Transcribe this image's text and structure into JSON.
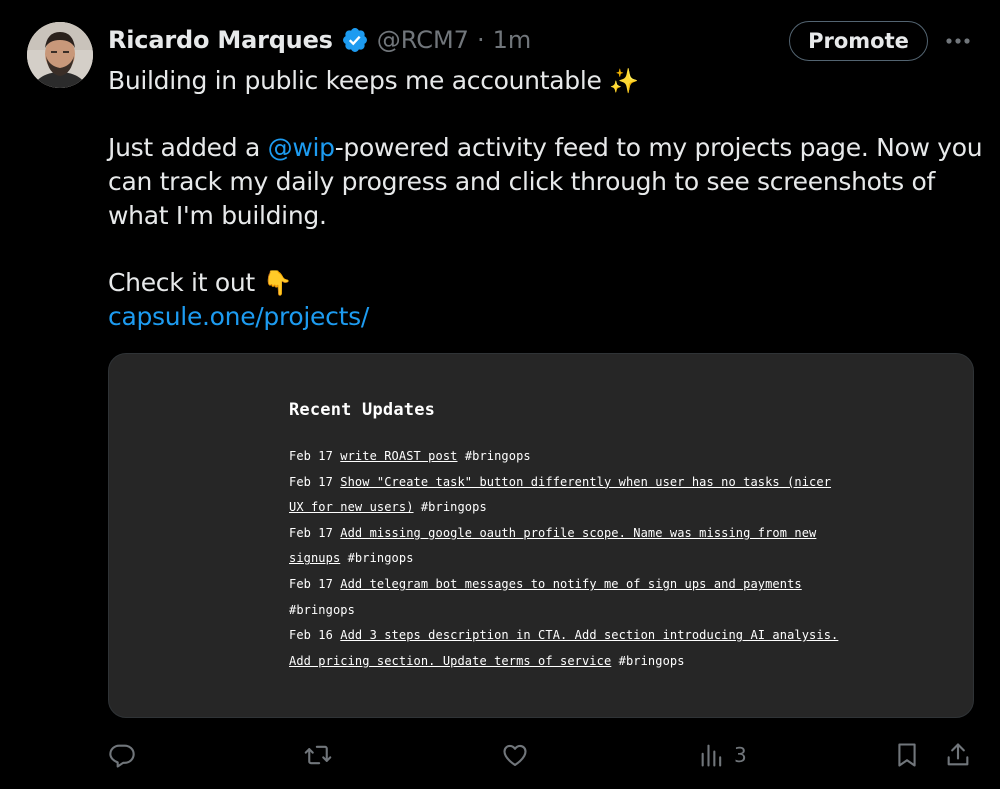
{
  "tweet": {
    "author_name": "Ricardo Marques",
    "handle": "@RCM7",
    "separator": "·",
    "time": "1m",
    "promote_label": "Promote",
    "text": {
      "line1": "Building in public keeps me accountable",
      "emoji_sparkles": "✨",
      "p2_before": "Just added a ",
      "p2_mention": "@wip",
      "p2_after": "-powered activity feed to my projects page. Now you can track my daily progress and click through to see screenshots of what I'm building.",
      "p3": "Check it out",
      "emoji_point": "👇",
      "link": "capsule.one/projects/"
    },
    "card": {
      "title": "Recent Updates",
      "updates": [
        {
          "date": "Feb 17",
          "text": "write ROAST post",
          "tag": "#bringops"
        },
        {
          "date": "Feb 17",
          "text": "Show \"Create task\" button differently when user has no tasks (nicer UX for new users)",
          "tag": "#bringops"
        },
        {
          "date": "Feb 17",
          "text": "Add missing google oauth profile scope. Name was missing from new signups",
          "tag": "#bringops"
        },
        {
          "date": "Feb 17",
          "text": "Add telegram bot messages to notify me of sign ups and payments",
          "tag": "#bringops"
        },
        {
          "date": "Feb 16",
          "text": "Add 3 steps description in CTA. Add section introducing AI analysis. Add pricing section. Update terms of service",
          "tag": "#bringops"
        }
      ]
    },
    "actions": {
      "reply_icon": "reply-icon",
      "retweet_icon": "retweet-icon",
      "like_icon": "heart-icon",
      "views_icon": "analytics-icon",
      "views_count": "3",
      "bookmark_icon": "bookmark-icon",
      "share_icon": "share-icon"
    }
  },
  "colors": {
    "background": "#000000",
    "text": "#e7e9ea",
    "muted": "#71767b",
    "accent": "#1d9bf0",
    "card_bg": "#262626"
  }
}
